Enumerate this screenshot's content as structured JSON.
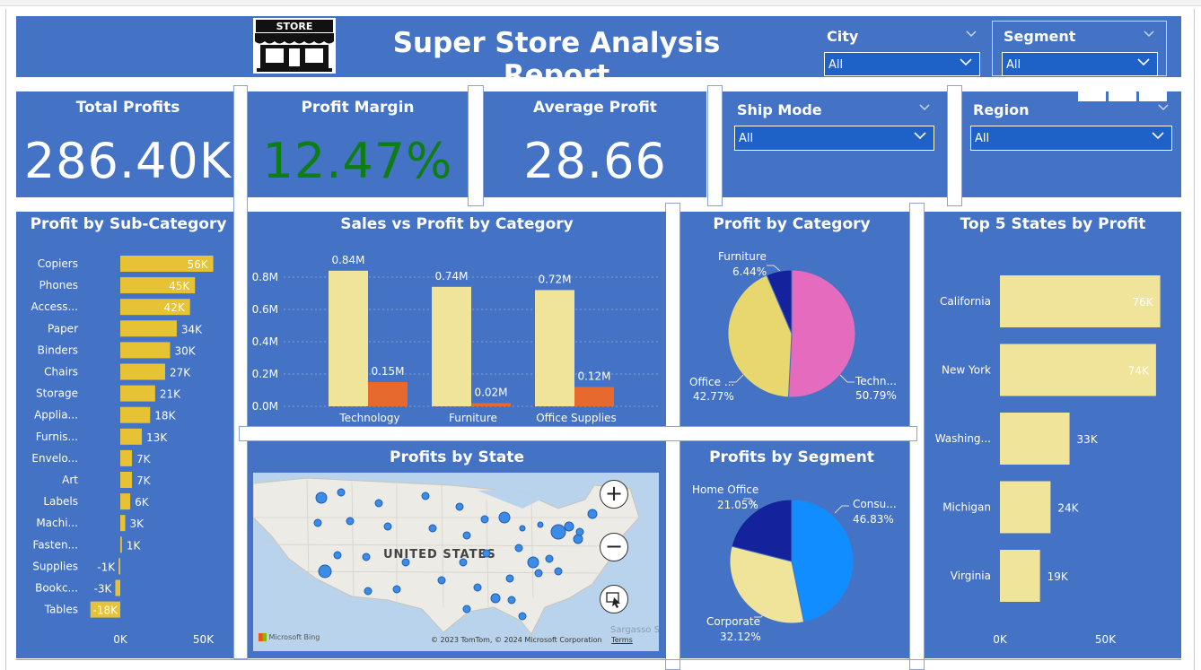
{
  "header": {
    "title": "Super Store Analysis Report",
    "logo_text": "STORE"
  },
  "slicers": {
    "city": {
      "label": "City",
      "value": "All"
    },
    "segment": {
      "label": "Segment",
      "value": "All"
    },
    "ship_mode": {
      "label": "Ship Mode",
      "value": "All"
    },
    "region": {
      "label": "Region",
      "value": "All"
    }
  },
  "kpis": {
    "total_profits": {
      "label": "Total Profits",
      "value": "286.40K"
    },
    "profit_margin": {
      "label": "Profit Margin",
      "value": "12.47%",
      "color": "#0e7d15"
    },
    "average_profit": {
      "label": "Average Profit",
      "value": "28.66"
    }
  },
  "colors": {
    "panel": "#4472c4",
    "bar_gold": "#e6c234",
    "bar_cream": "#f0e39a",
    "bar_orange": "#e8692e",
    "pie_pink": "#e46bbd",
    "pie_cream": "#e8d66e",
    "pie_navy": "#14229b",
    "seg_blue": "#118dff",
    "seg_cream": "#f0e39a",
    "seg_navy": "#14229b"
  },
  "map": {
    "title": "Profits by State",
    "country_label": "UNITED STATES",
    "credit": "© 2023 TomTom, © 2024 Microsoft Corporation",
    "terms": "Terms",
    "brand": "Microsoft Bing",
    "sea_label": "Sargasso S",
    "zoom_in": "+",
    "zoom_out": "−"
  },
  "chart_data": [
    {
      "type": "bar",
      "title": "Profit by Sub-Category",
      "orientation": "horizontal",
      "categories": [
        "Copiers",
        "Phones",
        "Access...",
        "Paper",
        "Binders",
        "Chairs",
        "Storage",
        "Applia...",
        "Furnis...",
        "Envelo...",
        "Art",
        "Labels",
        "Machi...",
        "Fasten...",
        "Supplies",
        "Bookc...",
        "Tables"
      ],
      "values": [
        56,
        45,
        42,
        34,
        30,
        27,
        21,
        18,
        13,
        7,
        7,
        6,
        3,
        1,
        -1,
        -3,
        -18
      ],
      "data_labels": [
        "56K",
        "45K",
        "42K",
        "34K",
        "30K",
        "27K",
        "21K",
        "18K",
        "13K",
        "7K",
        "7K",
        "6K",
        "3K",
        "1K",
        "-1K",
        "-3K",
        "-18K"
      ],
      "x_ticks": [
        "0K",
        "50K"
      ],
      "xlim": [
        -18,
        56
      ]
    },
    {
      "type": "bar",
      "title": "Sales vs Profit by Category",
      "categories": [
        "Technology",
        "Furniture",
        "Office Supplies"
      ],
      "series": [
        {
          "values": [
            0.84,
            0.74,
            0.72
          ],
          "labels": [
            "0.84M",
            "0.74M",
            "0.72M"
          ]
        },
        {
          "values": [
            0.15,
            0.02,
            0.12
          ],
          "labels": [
            "0.15M",
            "0.02M",
            "0.12M"
          ]
        }
      ],
      "y_ticks": [
        "0.0M",
        "0.2M",
        "0.4M",
        "0.6M",
        "0.8M"
      ],
      "ylim": [
        0,
        0.84
      ]
    },
    {
      "type": "pie",
      "title": "Profit by Category",
      "slices": [
        {
          "label": "Techn...",
          "pct": "50.79%",
          "value": 50.79
        },
        {
          "label": "Office ...",
          "pct": "42.77%",
          "value": 42.77
        },
        {
          "label": "Furniture",
          "pct": "6.44%",
          "value": 6.44
        }
      ]
    },
    {
      "type": "pie",
      "title": "Profits by Segment",
      "slices": [
        {
          "label": "Consu...",
          "pct": "46.83%",
          "value": 46.83
        },
        {
          "label": "Corporate",
          "pct": "32.12%",
          "value": 32.12
        },
        {
          "label": "Home Office",
          "pct": "21.05%",
          "value": 21.05
        }
      ]
    },
    {
      "type": "bar",
      "title": "Top 5 States by Profit",
      "orientation": "horizontal",
      "categories": [
        "California",
        "New York",
        "Washing...",
        "Michigan",
        "Virginia"
      ],
      "values": [
        76,
        74,
        33,
        24,
        19
      ],
      "data_labels": [
        "76K",
        "74K",
        "33K",
        "24K",
        "19K"
      ],
      "x_ticks": [
        "0K",
        "50K"
      ],
      "xlim": [
        0,
        76
      ]
    }
  ]
}
